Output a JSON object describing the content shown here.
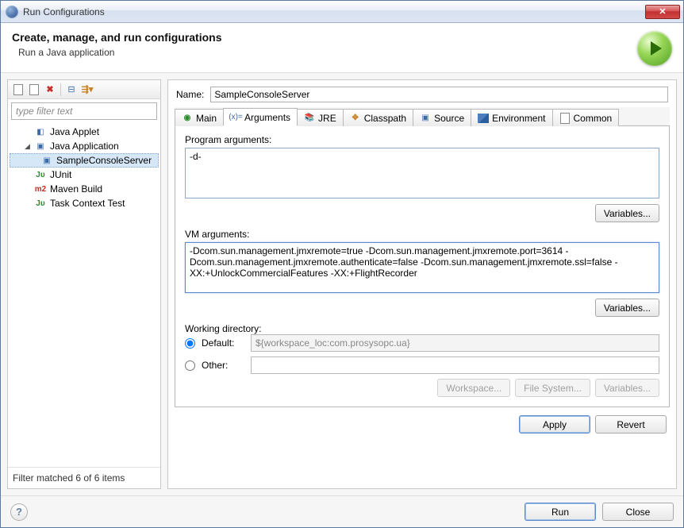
{
  "window": {
    "title": "Run Configurations"
  },
  "header": {
    "title": "Create, manage, and run configurations",
    "subtitle": "Run a Java application"
  },
  "left": {
    "filter_placeholder": "type filter text",
    "tree": [
      {
        "label": "Java Applet",
        "iconName": "applet-icon"
      },
      {
        "label": "Java Application",
        "iconName": "javaapp-icon",
        "expanded": true,
        "children": [
          {
            "label": "SampleConsoleServer",
            "iconName": "javaapp-icon",
            "selected": true
          }
        ]
      },
      {
        "label": "JUnit",
        "iconName": "junit-icon"
      },
      {
        "label": "Maven Build",
        "iconName": "m2-icon"
      },
      {
        "label": "Task Context Test",
        "iconName": "junit-icon"
      }
    ],
    "filter_status": "Filter matched 6 of 6 items"
  },
  "config": {
    "name_label": "Name:",
    "name_value": "SampleConsoleServer",
    "tabs": [
      {
        "id": "main",
        "label": "Main",
        "iconName": "play-icon"
      },
      {
        "id": "arguments",
        "label": "Arguments",
        "iconName": "args-icon",
        "active": true
      },
      {
        "id": "jre",
        "label": "JRE",
        "iconName": "jre-icon"
      },
      {
        "id": "classpath",
        "label": "Classpath",
        "iconName": "classpath-icon"
      },
      {
        "id": "source",
        "label": "Source",
        "iconName": "source-icon"
      },
      {
        "id": "environment",
        "label": "Environment",
        "iconName": "env-icon"
      },
      {
        "id": "common",
        "label": "Common",
        "iconName": "common-icon"
      }
    ],
    "args": {
      "program_label": "Program arguments:",
      "program_value": "-d-",
      "vm_label": "VM arguments:",
      "vm_value": "-Dcom.sun.management.jmxremote=true -Dcom.sun.management.jmxremote.port=3614 -Dcom.sun.management.jmxremote.authenticate=false -Dcom.sun.management.jmxremote.ssl=false -XX:+UnlockCommercialFeatures -XX:+FlightRecorder",
      "variables_btn": "Variables..."
    },
    "wd": {
      "section_label": "Working directory:",
      "default_label": "Default:",
      "default_value": "${workspace_loc:com.prosysopc.ua}",
      "other_label": "Other:",
      "workspace_btn": "Workspace...",
      "filesystem_btn": "File System...",
      "variables_btn": "Variables..."
    },
    "apply_btn": "Apply",
    "revert_btn": "Revert"
  },
  "footer": {
    "run_btn": "Run",
    "close_btn": "Close"
  }
}
